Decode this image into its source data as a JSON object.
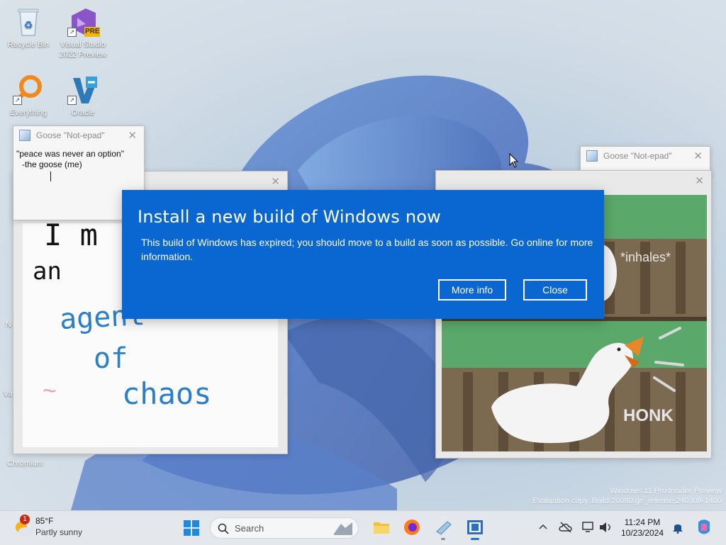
{
  "desktop_icons": [
    {
      "label": "Recycle Bin"
    },
    {
      "label": "Visual Studio 2022 Preview",
      "badge": "PRE"
    },
    {
      "label": "Everything"
    },
    {
      "label": "Oracle"
    }
  ],
  "left_edge_labels": {
    "chromium": "Chromium",
    "n": "N",
    "va": "Va"
  },
  "notepad_left": {
    "title": "Goose \"Not-epad\"",
    "line1": "\"peace was never an option\"",
    "line2": "-the goose (me)"
  },
  "notepad_right": {
    "title": "Goose \"Not-epad\""
  },
  "drawing_window": {
    "words": {
      "line1": "I m",
      "line2": "an",
      "line3": "agent",
      "line4": "of",
      "line5": "chaos",
      "squiggle": "~"
    }
  },
  "meme_window": {
    "inhales": "*inhales*",
    "honk": "HONK"
  },
  "dialog": {
    "title": "Install a new build of Windows now",
    "message": "This build of Windows has expired; you should move to a build as soon as possible. Go online for more information.",
    "more_info": "More info",
    "close": "Close",
    "accent": "#0a67d1"
  },
  "watermark": {
    "line1": "Windows 11 Pro Insider Preview",
    "line2": "Evaluation copy. Build 26080.ge_release.240308-1400"
  },
  "taskbar": {
    "weather": {
      "temp": "85°F",
      "condition": "Partly sunny",
      "badge": "1"
    },
    "search_placeholder": "Search",
    "time": "11:24 PM",
    "date": "10/23/2024"
  }
}
